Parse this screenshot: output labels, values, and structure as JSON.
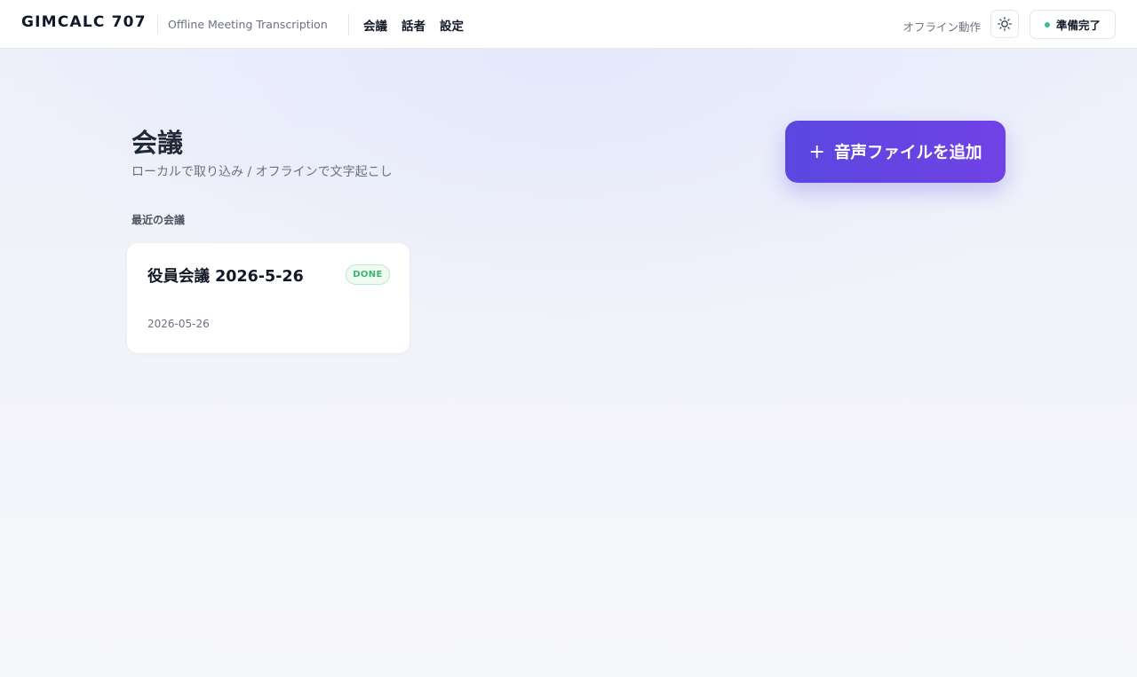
{
  "header": {
    "brand": "GIMCALC 707",
    "subtitle": "Offline Meeting Transcription",
    "nav": [
      {
        "label": "会議"
      },
      {
        "label": "話者"
      },
      {
        "label": "設定"
      }
    ],
    "offline_label": "オフライン動作",
    "theme_icon": "sun-icon",
    "status": {
      "label": "準備完了",
      "color": "#34c38f"
    }
  },
  "main": {
    "title": "会議",
    "subtitle": "ローカルで取り込み / オフラインで文字起こし",
    "add_button": {
      "icon": "plus-icon",
      "label": "音声ファイルを追加"
    },
    "section_label": "最近の会議",
    "meetings": [
      {
        "title": "役員会議 2026-5-26",
        "status": "DONE",
        "date": "2026-05-26"
      }
    ]
  },
  "colors": {
    "accent_start": "#5b47e0",
    "accent_end": "#7042e4",
    "done_badge": "#3bb56c",
    "ready_dot": "#34c38f"
  }
}
